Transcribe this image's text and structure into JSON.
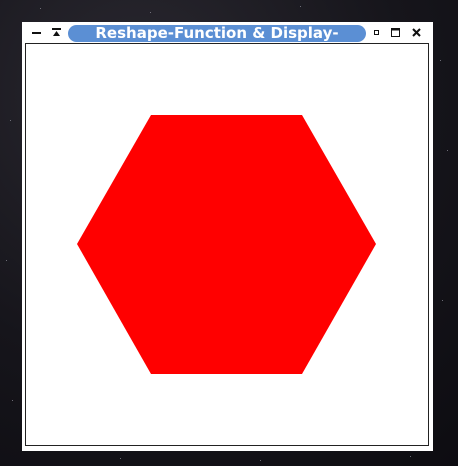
{
  "window": {
    "title": "Reshape-Function & Display-"
  },
  "titlebar_buttons": {
    "minimize": "minimize-icon",
    "shade": "shade-icon",
    "restore": "restore-icon",
    "maximize": "maximize-icon",
    "close": "close-icon"
  },
  "canvas": {
    "shape": "hexagon",
    "fill_color": "#ff0000",
    "background_color": "#ffffff"
  }
}
